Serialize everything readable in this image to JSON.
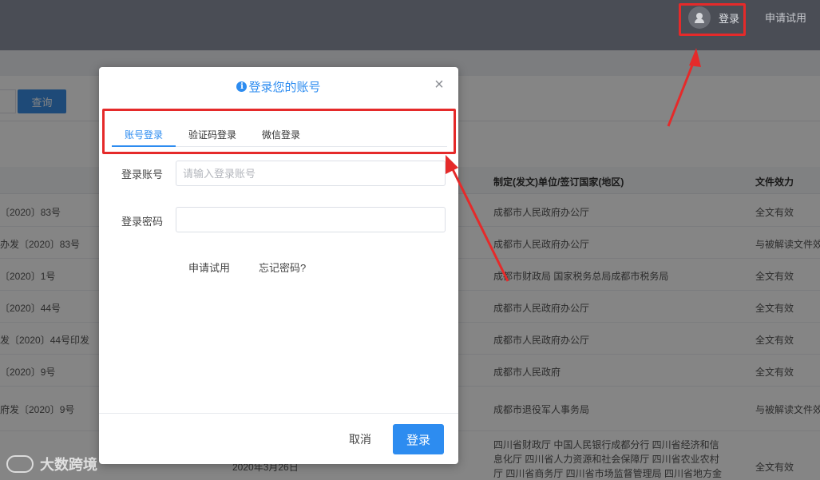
{
  "topbar": {
    "login_label": "登录",
    "trial_label": "申请试用"
  },
  "search": {
    "button_label": "查询"
  },
  "table": {
    "headers": {
      "issuer": "制定(发文)单位/签订国家(地区)",
      "validity": "文件效力"
    },
    "rows": [
      {
        "docno": "〔2020〕83号",
        "issuer": "成都市人民政府办公厅",
        "validity": "全文有效"
      },
      {
        "docno": "办发〔2020〕83号",
        "issuer": "成都市人民政府办公厅",
        "validity": "与被解读文件效"
      },
      {
        "docno": "〔2020〕1号",
        "issuer": "成都市财政局 国家税务总局成都市税务局",
        "validity": "全文有效"
      },
      {
        "docno": "〔2020〕44号",
        "issuer": "成都市人民政府办公厅",
        "validity": "全文有效"
      },
      {
        "docno": "发〔2020〕44号印发",
        "issuer": "成都市人民政府办公厅",
        "validity": "全文有效"
      },
      {
        "docno": "〔2020〕9号",
        "issuer": "成都市人民政府",
        "validity": "全文有效"
      },
      {
        "docno": "府发〔2020〕9号",
        "issuer": "成都市退役军人事务局",
        "validity": "与被解读文件效"
      },
      {
        "docno": "",
        "date": "2020年3月26日",
        "issuer": "四川省财政厅 中国人民银行成都分行 四川省经济和信息化厅 四川省人力资源和社会保障厅 四川省农业农村厅 四川省商务厅 四川省市场监督管理局 四川省地方金",
        "validity": "全文有效"
      }
    ]
  },
  "modal": {
    "title": "登录您的账号",
    "close_symbol": "×",
    "tabs": [
      "账号登录",
      "验证码登录",
      "微信登录"
    ],
    "account_label": "登录账号",
    "account_placeholder": "请输入登录账号",
    "password_label": "登录密码",
    "password_value": "",
    "apply_trial_link": "申请试用",
    "forgot_password_link": "忘记密码?",
    "cancel_label": "取消",
    "login_label": "登录"
  },
  "watermark": {
    "text": "大数跨境"
  },
  "colors": {
    "topbar": "#4a4d55",
    "accent": "#2d8cf0",
    "annotation_red": "#e52a2a"
  }
}
